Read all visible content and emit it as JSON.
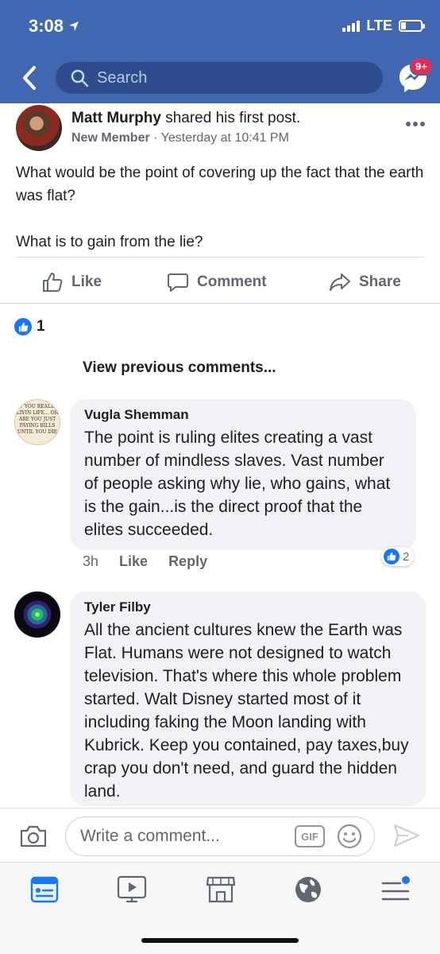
{
  "status_bar": {
    "time": "3:08",
    "network": "LTE"
  },
  "header": {
    "search_placeholder": "Search",
    "messenger_badge": "9+",
    "accent_color": "#4267b2"
  },
  "post": {
    "author": "Matt Murphy",
    "action": "shared his first post.",
    "role": "New Member",
    "separator": "·",
    "timestamp": "Yesterday at 10:41 PM",
    "body_line1": "What would be the point of covering up the fact that the earth was flat?",
    "body_line2": "What is to gain from the lie?",
    "actions": {
      "like": "Like",
      "comment": "Comment",
      "share": "Share"
    },
    "reaction_count": "1"
  },
  "view_previous": "View previous comments...",
  "comments": [
    {
      "name": "Vugla Shemman",
      "text": "The point is ruling elites creating a vast number of mindless slaves. Vast number of people asking why lie, who gains, what is the gain...is the direct proof that the elites succeeded.",
      "time": "3h",
      "like": "Like",
      "reply": "Reply",
      "reactions": "2",
      "avatar_text": "IF YOU REALLY LIVIN LIFE... OR ARE YOU JUST PAYING BILLS UNTIL YOU DIE"
    },
    {
      "name": "Tyler Filby",
      "text": "All the ancient cultures knew the Earth was Flat. Humans were not designed to watch television. That's where this whole problem started. Walt Disney started most of it including faking the Moon landing with Kubrick. Keep you contained, pay taxes,buy crap you don't need, and guard the hidden land."
    }
  ],
  "composer": {
    "placeholder": "Write a comment...",
    "gif_label": "GIF"
  },
  "tabbar": {
    "icons": [
      "news-feed-icon",
      "watch-icon",
      "marketplace-icon",
      "notifications-globe-icon",
      "menu-icon"
    ],
    "active_color": "#1877f2"
  }
}
